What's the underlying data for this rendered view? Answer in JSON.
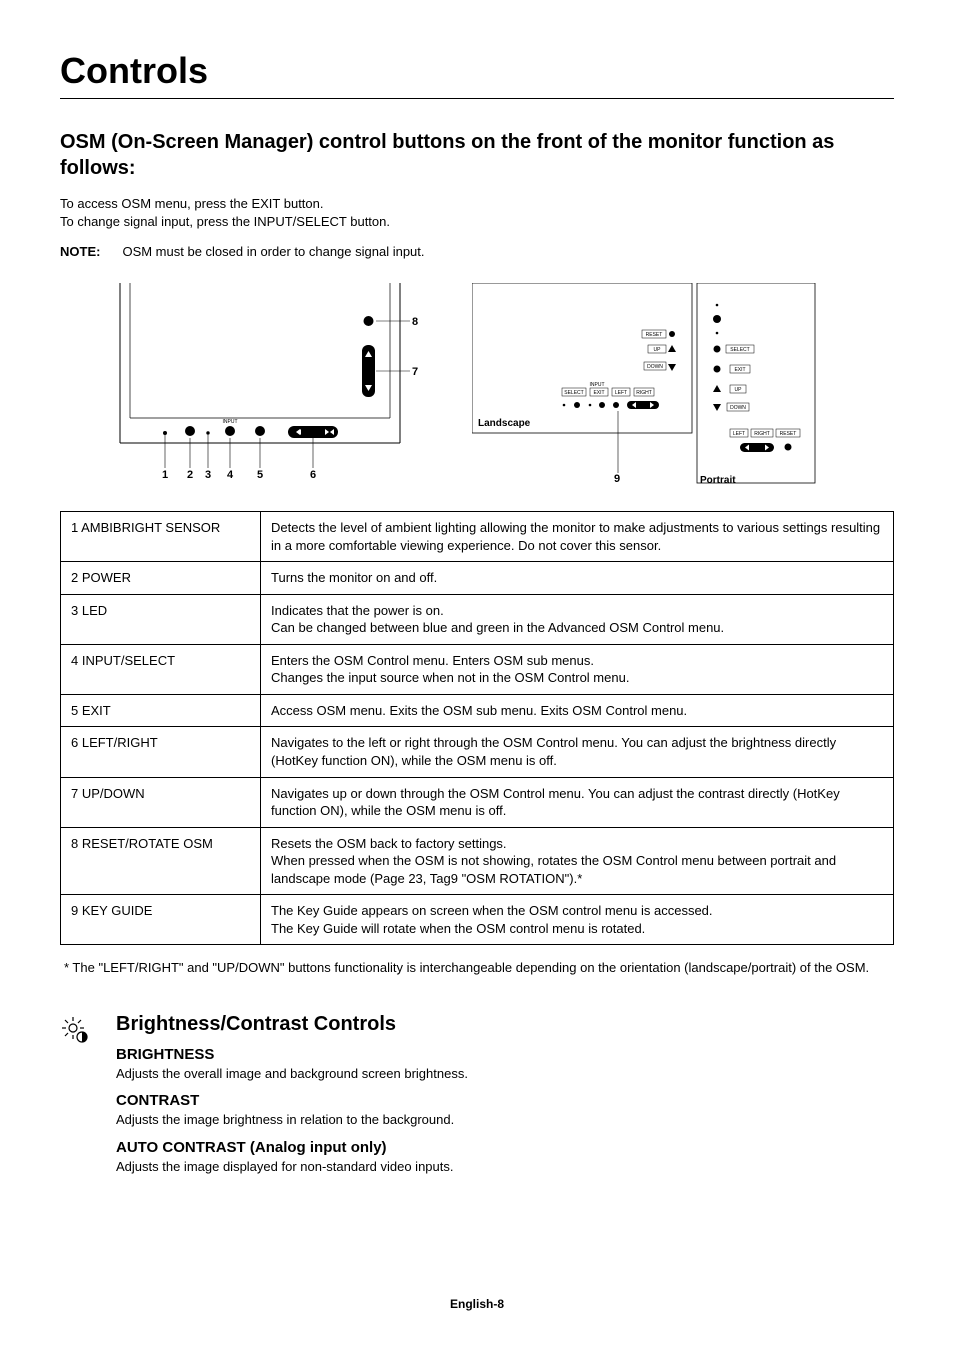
{
  "title": "Controls",
  "section_heading": "OSM (On-Screen Manager) control buttons on the front of the monitor function as follows:",
  "intro": {
    "line1": "To access OSM menu, press the EXIT button.",
    "line2": "To change signal input, press the INPUT/SELECT button."
  },
  "note": {
    "label": "NOTE:",
    "text": "OSM must be closed in order to change signal input."
  },
  "diagram": {
    "nums": {
      "n1": "1",
      "n2": "2",
      "n3": "3",
      "n4": "4",
      "n5": "5",
      "n6": "6",
      "n7": "7",
      "n8": "8",
      "n9": "9"
    },
    "landscape_label": "Landscape",
    "portrait_label": "Portrait",
    "btn_labels": {
      "input": "INPUT",
      "select": "SELECT",
      "exit": "EXIT",
      "left": "LEFT",
      "right": "RIGHT",
      "up": "UP",
      "down": "DOWN",
      "reset": "RESET"
    }
  },
  "table": [
    {
      "label": "1 AMBIBRIGHT SENSOR",
      "desc": "Detects the level of ambient lighting allowing the monitor to make adjustments to various settings resulting in a more comfortable viewing experience. Do not cover this sensor."
    },
    {
      "label": "2 POWER",
      "desc": "Turns the monitor on and off."
    },
    {
      "label": "3 LED",
      "desc": "Indicates that the power is on.\nCan be changed between blue and green in the Advanced OSM Control menu."
    },
    {
      "label": "4 INPUT/SELECT",
      "desc": "Enters the OSM Control menu. Enters OSM sub menus.\nChanges the input source when not in the OSM Control menu."
    },
    {
      "label": "5 EXIT",
      "desc": "Access OSM menu. Exits the OSM sub menu. Exits OSM Control menu."
    },
    {
      "label": "6 LEFT/RIGHT",
      "desc": "Navigates to the left or right through the OSM Control menu. You can adjust the brightness directly (HotKey function ON), while the OSM menu is off."
    },
    {
      "label": "7 UP/DOWN",
      "desc": "Navigates up or down through the OSM Control menu. You can adjust the contrast directly (HotKey function ON), while the OSM menu is off."
    },
    {
      "label": "8 RESET/ROTATE OSM",
      "desc": "Resets the OSM back to factory settings.\nWhen pressed when the OSM is not showing, rotates the OSM Control menu between portrait and landscape mode (Page 23, Tag9 \"OSM ROTATION\").*"
    },
    {
      "label": "9 KEY GUIDE",
      "desc": "The Key Guide appears on screen when the OSM control menu is accessed.\nThe Key Guide will rotate when the OSM control menu is rotated."
    }
  ],
  "footnote": "*  The \"LEFT/RIGHT\" and \"UP/DOWN\" buttons functionality is interchangeable depending on the orientation (landscape/portrait) of the OSM.",
  "bc": {
    "heading": "Brightness/Contrast Controls",
    "brightness": {
      "title": "BRIGHTNESS",
      "text": "Adjusts the overall image and background screen brightness."
    },
    "contrast": {
      "title": "CONTRAST",
      "text": "Adjusts the image brightness in relation to the background."
    },
    "auto_contrast": {
      "title": "AUTO CONTRAST (Analog input only)",
      "text": "Adjusts the image displayed for non-standard video inputs."
    }
  },
  "footer": "English-8"
}
